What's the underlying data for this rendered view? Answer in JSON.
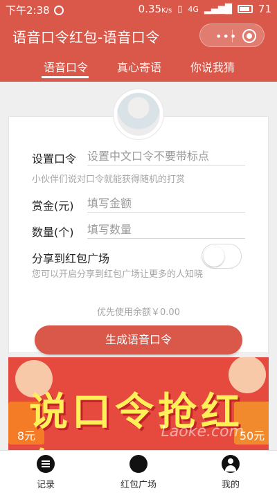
{
  "status": {
    "time": "下午2:38",
    "speed": "0.35",
    "speed_unit": "K/s",
    "network": "4G",
    "battery": "71"
  },
  "header": {
    "title": "语音口令红包-语音口令",
    "tabs": [
      {
        "label": "语音口令",
        "active": true
      },
      {
        "label": "真心寄语",
        "active": false
      },
      {
        "label": "你说我猜",
        "active": false
      }
    ]
  },
  "form": {
    "password_label": "设置口令",
    "password_placeholder": "设置中文口令不要带标点",
    "password_hint": "小伙伴们说对口令就能获得随机的打赏",
    "amount_label": "赏金(元)",
    "amount_placeholder": "填写金额",
    "count_label": "数量(个)",
    "count_placeholder": "填写数量",
    "share_label": "分享到红包广场",
    "share_hint": "您可以开启分享到红包广场让更多的人知晓",
    "share_enabled": false,
    "balance_text": "优先使用余额￥0.00",
    "submit_label": "生成语音口令"
  },
  "banner": {
    "headline": "说口令抢红包",
    "left_amount": "8元",
    "right_amount": "50元",
    "watermark": "Laoke.com"
  },
  "bottom_nav": [
    {
      "label": "记录",
      "icon": "list-icon"
    },
    {
      "label": "红包广场",
      "icon": "grid-icon"
    },
    {
      "label": "我的",
      "icon": "user-icon"
    }
  ],
  "colors": {
    "brand": "#d9584a",
    "banner": "#e6493e",
    "banner_text": "#fff05a"
  }
}
